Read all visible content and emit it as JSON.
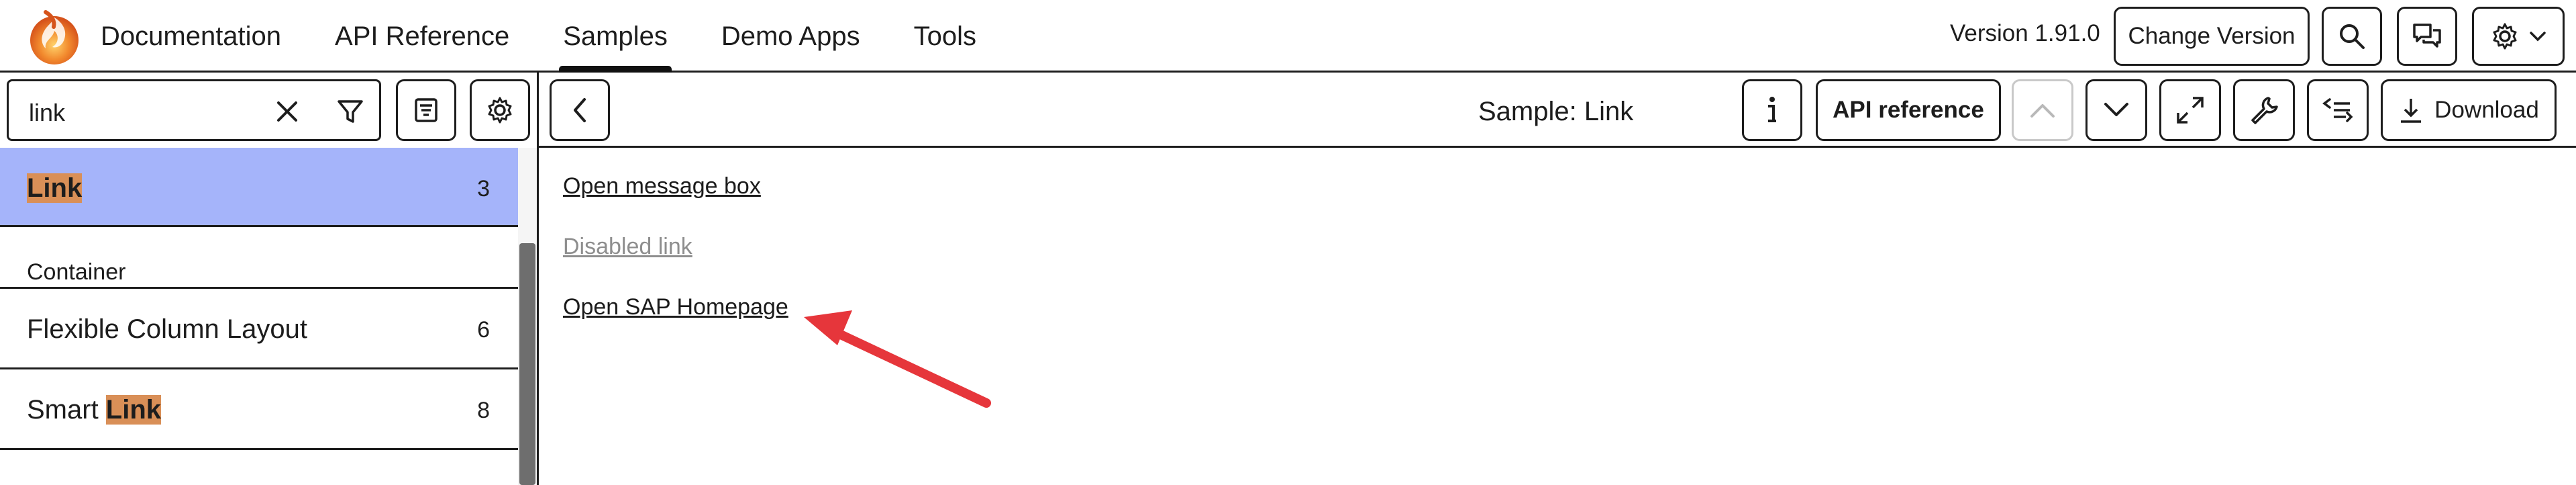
{
  "shell": {
    "nav": [
      {
        "label": "Documentation"
      },
      {
        "label": "API Reference"
      },
      {
        "label": "Samples",
        "active": true
      },
      {
        "label": "Demo Apps"
      },
      {
        "label": "Tools"
      }
    ],
    "version": "Version 1.91.0",
    "change_version_label": "Change Version",
    "icons": [
      "search-icon",
      "feedback-icon",
      "settings-icon",
      "chevron-down-icon"
    ]
  },
  "left": {
    "search_value": "link",
    "icons": [
      "clear-icon",
      "filter-icon",
      "sort-icon",
      "settings-icon"
    ],
    "items": [
      {
        "pre": "",
        "hit": "Link",
        "post": "",
        "count": "3",
        "selected": true
      },
      {
        "group": "Container"
      },
      {
        "pre": "Flexible Column Layout",
        "hit": "",
        "post": "",
        "count": "6"
      },
      {
        "pre": "Smart ",
        "hit": "Link",
        "post": "",
        "count": "8"
      }
    ]
  },
  "right": {
    "title": "Sample: Link",
    "api_reference_label": "API reference",
    "download_label": "Download",
    "icons": [
      "back-icon",
      "info-icon",
      "chevron-up-icon",
      "chevron-down-icon",
      "fullscreen-icon",
      "wrench-icon",
      "code-icon",
      "download-icon"
    ],
    "links": [
      {
        "label": "Open message box",
        "disabled": false
      },
      {
        "label": "Disabled link",
        "disabled": true
      },
      {
        "label": "Open SAP Homepage",
        "disabled": false
      }
    ]
  },
  "colors": {
    "highlight": "#a5b4fa",
    "search_hit": "#d98f57",
    "annotation_arrow": "#e6363b"
  }
}
